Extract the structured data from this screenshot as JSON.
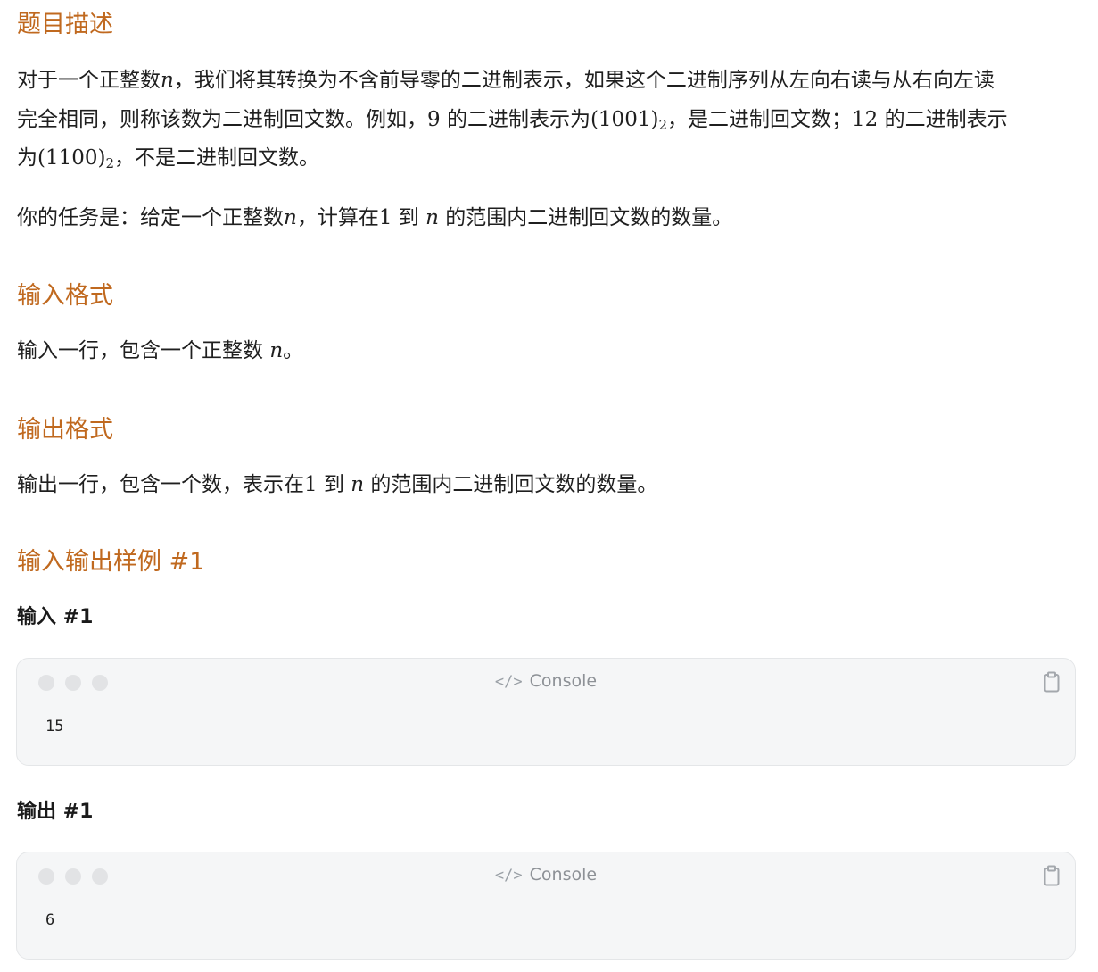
{
  "sections": {
    "description_title": "题目描述",
    "input_format_title": "输入格式",
    "output_format_title": "输出格式",
    "sample_title": "输入输出样例 #1"
  },
  "description": {
    "l1_a": "对于一个正整数",
    "l1_n": "n",
    "l1_b": "，我们将其转换为不含前导零的二进制表示，如果这个二进制序列从左向右读与从右向左读",
    "l2_a": "完全相同，则称该数为二进制回文数。例如，",
    "l2_9": "9",
    "l2_b": "的二进制表示为",
    "l2_num1": "(1001)",
    "l2_sub1": "2",
    "l2_c": "，是二进制回文数；",
    "l2_12": "12",
    "l2_d": "的二进制表示",
    "l3_a": "为",
    "l3_num2": "(1100)",
    "l3_sub2": "2",
    "l3_b": "，不是二进制回文数。",
    "task_a": "你的任务是：给定一个正整数",
    "task_n": "n",
    "task_b": "，计算在",
    "task_1": "1",
    "task_c": "到",
    "task_n2": "n",
    "task_d": "的范围内二进制回文数的数量。"
  },
  "input_format": {
    "a": "输入一行，包含一个正整数",
    "n": "n",
    "b": "。"
  },
  "output_format": {
    "a": "输出一行，包含一个数，表示在",
    "one": "1",
    "b": "到",
    "n": "n",
    "c": "的范围内二进制回文数的数量。"
  },
  "sample": {
    "input_label": "输入 #1",
    "output_label": "输出 #1",
    "console_label": "Console",
    "console_icon": "code-icon",
    "copy_icon": "clipboard-icon",
    "input_value": "15",
    "output_value": "6"
  },
  "colors": {
    "heading": "#c0691f",
    "console_bg": "#f5f6f7"
  }
}
